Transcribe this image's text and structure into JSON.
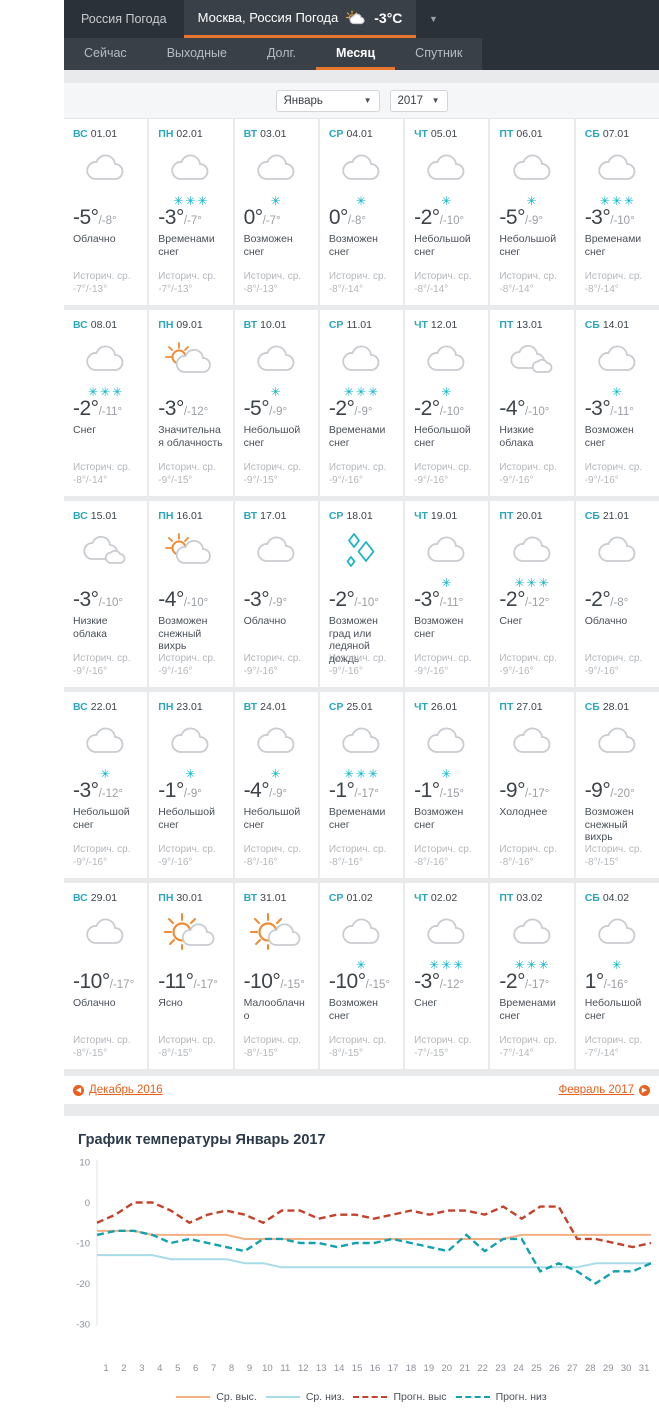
{
  "header": {
    "brand": "Россия Погода",
    "location_tab": "Москва, Россия Погода",
    "location_temp": "-3°C",
    "dropdown_caret": "▼",
    "nav": [
      {
        "label": "Сейчас",
        "active": false
      },
      {
        "label": "Выходные",
        "active": false
      },
      {
        "label": "Долг.",
        "active": false
      },
      {
        "label": "Месяц",
        "active": true
      },
      {
        "label": "Спутник",
        "active": false
      }
    ]
  },
  "selectors": {
    "month": "Январь",
    "year": "2017",
    "arrow": "▼"
  },
  "calendar": {
    "hist_label": "Историч. ср.",
    "weeks": [
      [
        {
          "dow": "ВС",
          "date": "01.01",
          "icon": "cloudy",
          "flakes": 0,
          "high": "-5°",
          "low": "/-8°",
          "cond": "Облачно",
          "hist": "-7°/-13°"
        },
        {
          "dow": "ПН",
          "date": "02.01",
          "icon": "cloudy",
          "flakes": 3,
          "high": "-3°",
          "low": "/-7°",
          "cond": "Временами снег",
          "hist": "-7°/-13°"
        },
        {
          "dow": "ВТ",
          "date": "03.01",
          "icon": "cloudy",
          "flakes": 1,
          "high": "0°",
          "low": "/-7°",
          "cond": "Возможен снег",
          "hist": "-8°/-13°"
        },
        {
          "dow": "СР",
          "date": "04.01",
          "icon": "cloudy",
          "flakes": 1,
          "high": "0°",
          "low": "/-8°",
          "cond": "Возможен снег",
          "hist": "-8°/-14°"
        },
        {
          "dow": "ЧТ",
          "date": "05.01",
          "icon": "cloudy",
          "flakes": 1,
          "high": "-2°",
          "low": "/-10°",
          "cond": "Небольшой снег",
          "hist": "-8°/-14°"
        },
        {
          "dow": "ПТ",
          "date": "06.01",
          "icon": "cloudy",
          "flakes": 1,
          "high": "-5°",
          "low": "/-9°",
          "cond": "Небольшой снег",
          "hist": "-8°/-14°"
        },
        {
          "dow": "СБ",
          "date": "07.01",
          "icon": "cloudy",
          "flakes": 3,
          "high": "-3°",
          "low": "/-10°",
          "cond": "Временами снег",
          "hist": "-8°/-14°"
        }
      ],
      [
        {
          "dow": "ВС",
          "date": "08.01",
          "icon": "cloudy",
          "flakes": 3,
          "high": "-2°",
          "low": "/-11°",
          "cond": "Снег",
          "hist": "-8°/-14°"
        },
        {
          "dow": "ПН",
          "date": "09.01",
          "icon": "partly",
          "flakes": 0,
          "high": "-3°",
          "low": "/-12°",
          "cond": "Значительная облачность",
          "hist": "-9°/-15°"
        },
        {
          "dow": "ВТ",
          "date": "10.01",
          "icon": "cloudy",
          "flakes": 1,
          "high": "-5°",
          "low": "/-9°",
          "cond": "Небольшой снег",
          "hist": "-9°/-15°"
        },
        {
          "dow": "СР",
          "date": "11.01",
          "icon": "cloudy",
          "flakes": 3,
          "high": "-2°",
          "low": "/-9°",
          "cond": "Временами снег",
          "hist": "-9°/-16°"
        },
        {
          "dow": "ЧТ",
          "date": "12.01",
          "icon": "cloudy",
          "flakes": 1,
          "high": "-2°",
          "low": "/-10°",
          "cond": "Небольшой снег",
          "hist": "-9°/-16°"
        },
        {
          "dow": "ПТ",
          "date": "13.01",
          "icon": "lowcloud",
          "flakes": 0,
          "high": "-4°",
          "low": "/-10°",
          "cond": "Низкие облака",
          "hist": "-9°/-16°"
        },
        {
          "dow": "СБ",
          "date": "14.01",
          "icon": "cloudy",
          "flakes": 1,
          "high": "-3°",
          "low": "/-11°",
          "cond": "Возможен снег",
          "hist": "-9°/-16°"
        }
      ],
      [
        {
          "dow": "ВС",
          "date": "15.01",
          "icon": "lowcloud",
          "flakes": 0,
          "high": "-3°",
          "low": "/-10°",
          "cond": "Низкие облака",
          "hist": "-9°/-16°"
        },
        {
          "dow": "ПН",
          "date": "16.01",
          "icon": "partly",
          "flakes": 0,
          "high": "-4°",
          "low": "/-10°",
          "cond": "Возможен снежный вихрь",
          "hist": "-9°/-16°"
        },
        {
          "dow": "ВТ",
          "date": "17.01",
          "icon": "cloudy",
          "flakes": 0,
          "high": "-3°",
          "low": "/-9°",
          "cond": "Облачно",
          "hist": "-9°/-16°"
        },
        {
          "dow": "СР",
          "date": "18.01",
          "icon": "hail",
          "flakes": 0,
          "high": "-2°",
          "low": "/-10°",
          "cond": "Возможен град или ледяной дождь",
          "hist": "-9°/-16°"
        },
        {
          "dow": "ЧТ",
          "date": "19.01",
          "icon": "cloudy",
          "flakes": 1,
          "high": "-3°",
          "low": "/-11°",
          "cond": "Возможен снег",
          "hist": "-9°/-16°"
        },
        {
          "dow": "ПТ",
          "date": "20.01",
          "icon": "cloudy",
          "flakes": 3,
          "high": "-2°",
          "low": "/-12°",
          "cond": "Снег",
          "hist": "-9°/-16°"
        },
        {
          "dow": "СБ",
          "date": "21.01",
          "icon": "cloudy",
          "flakes": 0,
          "high": "-2°",
          "low": "/-8°",
          "cond": "Облачно",
          "hist": "-9°/-16°"
        }
      ],
      [
        {
          "dow": "ВС",
          "date": "22.01",
          "icon": "cloudy",
          "flakes": 1,
          "high": "-3°",
          "low": "/-12°",
          "cond": "Небольшой снег",
          "hist": "-9°/-16°"
        },
        {
          "dow": "ПН",
          "date": "23.01",
          "icon": "cloudy",
          "flakes": 1,
          "high": "-1°",
          "low": "/-9°",
          "cond": "Небольшой снег",
          "hist": "-9°/-16°"
        },
        {
          "dow": "ВТ",
          "date": "24.01",
          "icon": "cloudy",
          "flakes": 1,
          "high": "-4°",
          "low": "/-9°",
          "cond": "Небольшой снег",
          "hist": "-8°/-16°"
        },
        {
          "dow": "СР",
          "date": "25.01",
          "icon": "cloudy",
          "flakes": 3,
          "high": "-1°",
          "low": "/-17°",
          "cond": "Временами снег",
          "hist": "-8°/-16°"
        },
        {
          "dow": "ЧТ",
          "date": "26.01",
          "icon": "cloudy",
          "flakes": 1,
          "high": "-1°",
          "low": "/-15°",
          "cond": "Возможен снег",
          "hist": "-8°/-16°"
        },
        {
          "dow": "ПТ",
          "date": "27.01",
          "icon": "cloudy",
          "flakes": 0,
          "high": "-9°",
          "low": "/-17°",
          "cond": "Холоднее",
          "hist": "-8°/-16°"
        },
        {
          "dow": "СБ",
          "date": "28.01",
          "icon": "cloudy",
          "flakes": 0,
          "high": "-9°",
          "low": "/-20°",
          "cond": "Возможен снежный вихрь",
          "hist": "-8°/-15°"
        }
      ],
      [
        {
          "dow": "ВС",
          "date": "29.01",
          "icon": "cloudy",
          "flakes": 0,
          "high": "-10°",
          "low": "/-17°",
          "cond": "Облачно",
          "hist": "-8°/-15°"
        },
        {
          "dow": "ПН",
          "date": "30.01",
          "icon": "sunny",
          "flakes": 0,
          "high": "-11°",
          "low": "/-17°",
          "cond": "Ясно",
          "hist": "-8°/-15°"
        },
        {
          "dow": "ВТ",
          "date": "31.01",
          "icon": "sunny",
          "flakes": 0,
          "high": "-10°",
          "low": "/-15°",
          "cond": "Малооблачно",
          "hist": "-8°/-15°"
        },
        {
          "dow": "СР",
          "date": "01.02",
          "icon": "cloudy",
          "flakes": 1,
          "high": "-10°",
          "low": "/-15°",
          "cond": "Возможен снег",
          "hist": "-8°/-15°"
        },
        {
          "dow": "ЧТ",
          "date": "02.02",
          "icon": "cloudy",
          "flakes": 3,
          "high": "-3°",
          "low": "/-12°",
          "cond": "Снег",
          "hist": "-7°/-15°"
        },
        {
          "dow": "ПТ",
          "date": "03.02",
          "icon": "cloudy",
          "flakes": 3,
          "high": "-2°",
          "low": "/-17°",
          "cond": "Временами снег",
          "hist": "-7°/-14°"
        },
        {
          "dow": "СБ",
          "date": "04.02",
          "icon": "cloudy",
          "flakes": 1,
          "high": "1°",
          "low": "/-16°",
          "cond": "Небольшой снег",
          "hist": "-7°/-14°"
        }
      ]
    ]
  },
  "month_nav": {
    "prev": "Декабрь 2016",
    "next": "Февраль 2017",
    "prev_glyph": "◀",
    "next_glyph": "▶"
  },
  "chart_data": {
    "type": "line",
    "title": "График температуры Январь 2017",
    "xlabel": "",
    "ylabel": "",
    "ylim": [
      -30,
      10
    ],
    "yticks": [
      10,
      0,
      -10,
      -20,
      -30
    ],
    "grid": false,
    "legend_position": "bottom",
    "x": [
      1,
      2,
      3,
      4,
      5,
      6,
      7,
      8,
      9,
      10,
      11,
      12,
      13,
      14,
      15,
      16,
      17,
      18,
      19,
      20,
      21,
      22,
      23,
      24,
      25,
      26,
      27,
      28,
      29,
      30,
      31
    ],
    "series": [
      {
        "name": "Ср. выс.",
        "style": "solid",
        "color": "#f3b183",
        "values": [
          -7,
          -7,
          -7,
          -8,
          -8,
          -8,
          -8,
          -8,
          -9,
          -9,
          -9,
          -9,
          -9,
          -9,
          -9,
          -9,
          -9,
          -9,
          -9,
          -9,
          -9,
          -9,
          -9,
          -8,
          -8,
          -8,
          -8,
          -8,
          -8,
          -8,
          -8
        ]
      },
      {
        "name": "Ср. низ.",
        "style": "solid",
        "color": "#a9dbe8",
        "values": [
          -13,
          -13,
          -13,
          -13,
          -14,
          -14,
          -14,
          -14,
          -15,
          -15,
          -16,
          -16,
          -16,
          -16,
          -16,
          -16,
          -16,
          -16,
          -16,
          -16,
          -16,
          -16,
          -16,
          -16,
          -16,
          -16,
          -16,
          -15,
          -15,
          -15,
          -15
        ]
      },
      {
        "name": "Прогн. выс",
        "style": "dashed",
        "color": "#c3422c",
        "values": [
          -5,
          -3,
          0,
          0,
          -2,
          -5,
          -3,
          -2,
          -3,
          -5,
          -2,
          -2,
          -4,
          -3,
          -3,
          -4,
          -3,
          -2,
          -3,
          -2,
          -2,
          -3,
          -1,
          -4,
          -1,
          -1,
          -9,
          -9,
          -10,
          -11,
          -10
        ]
      },
      {
        "name": "Прогн. низ",
        "style": "dashed",
        "color": "#12a1b0",
        "values": [
          -8,
          -7,
          -7,
          -8,
          -10,
          -9,
          -10,
          -11,
          -12,
          -9,
          -9,
          -10,
          -10,
          -11,
          -10,
          -10,
          -9,
          -10,
          -11,
          -12,
          -8,
          -12,
          -9,
          -9,
          -17,
          -15,
          -17,
          -20,
          -17,
          -17,
          -15
        ]
      }
    ]
  }
}
